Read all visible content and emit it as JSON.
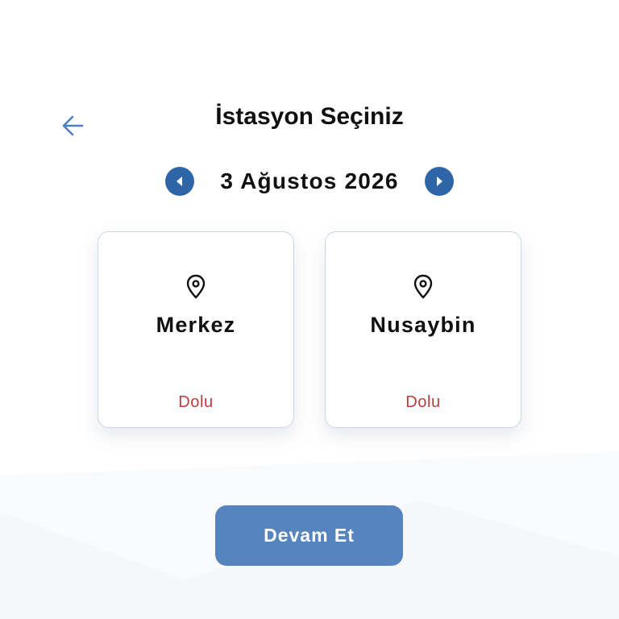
{
  "header": {
    "title": "İstasyon Seçiniz",
    "back_icon": "arrow-left-icon"
  },
  "date_nav": {
    "date": "3 Ağustos 2026",
    "prev_icon": "chevron-left-icon",
    "next_icon": "chevron-right-icon"
  },
  "stations": [
    {
      "name": "Merkez",
      "status": "Dolu",
      "icon": "location-pin-icon"
    },
    {
      "name": "Nusaybin",
      "status": "Dolu",
      "icon": "location-pin-icon"
    }
  ],
  "footer": {
    "continue_label": "Devam Et"
  },
  "colors": {
    "accent": "#2d65a8",
    "button": "#5584be",
    "status_full": "#c0393b",
    "back_arrow": "#4f7fbd"
  }
}
